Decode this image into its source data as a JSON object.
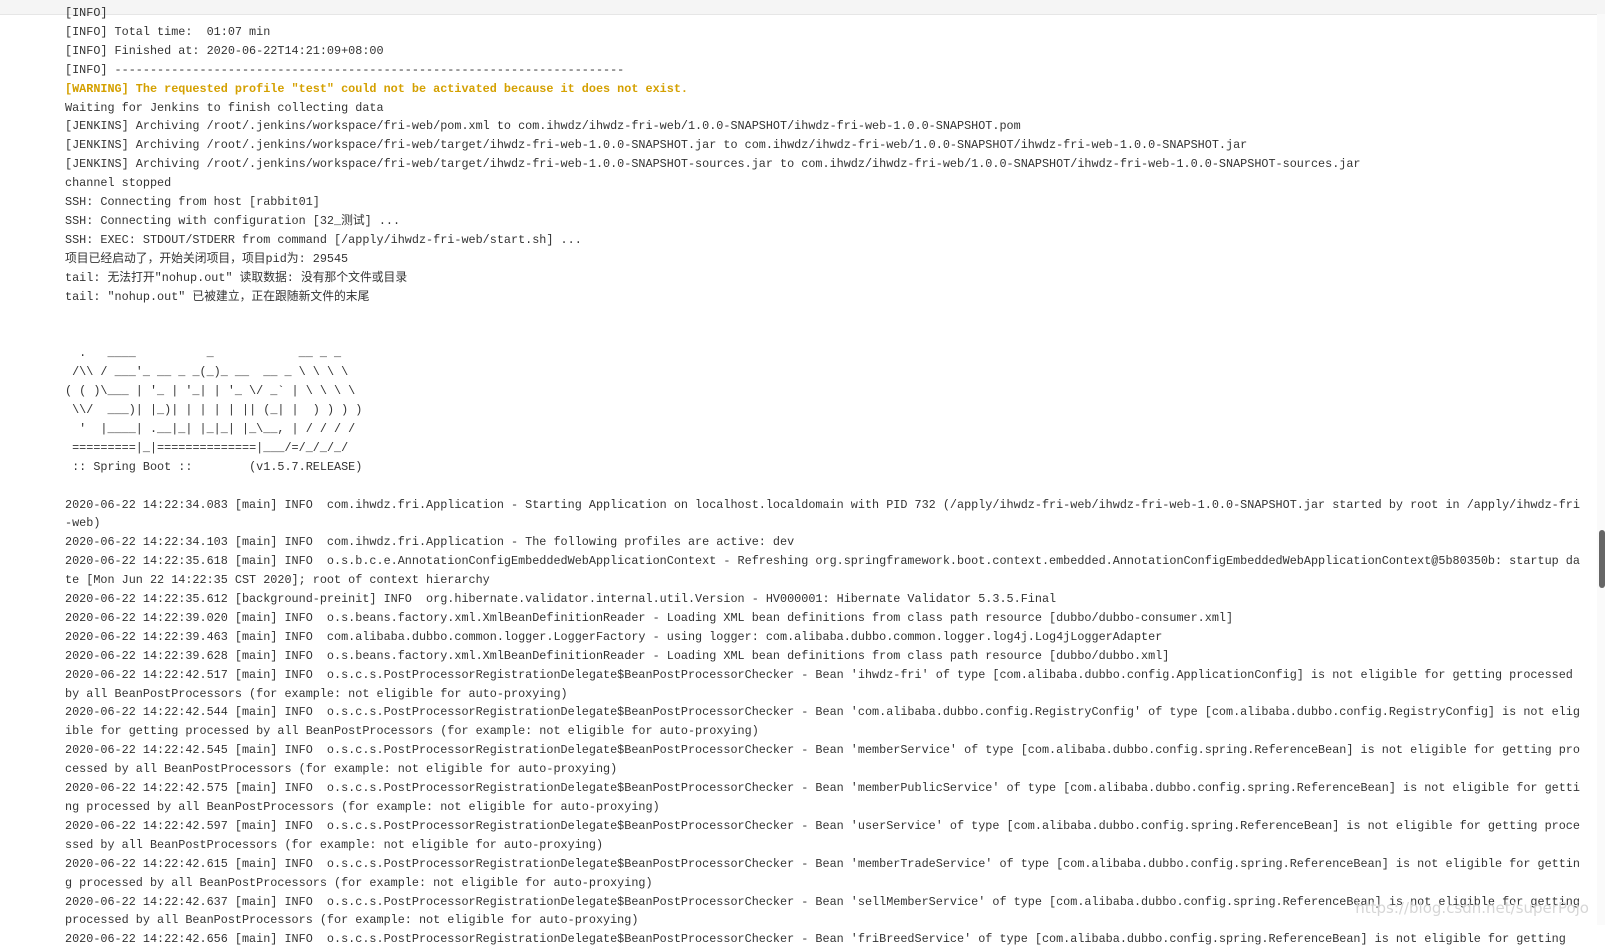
{
  "lines": [
    {
      "text": "[INFO]",
      "cls": ""
    },
    {
      "text": "[INFO] Total time:  01:07 min",
      "cls": ""
    },
    {
      "text": "[INFO] Finished at: 2020-06-22T14:21:09+08:00",
      "cls": ""
    },
    {
      "text": "[INFO] ------------------------------------------------------------------------",
      "cls": ""
    },
    {
      "text": "[WARNING] The requested profile \"test\" could not be activated because it does not exist.",
      "cls": "warn"
    },
    {
      "text": "Waiting for Jenkins to finish collecting data",
      "cls": ""
    },
    {
      "text": "[JENKINS] Archiving /root/.jenkins/workspace/fri-web/pom.xml to com.ihwdz/ihwdz-fri-web/1.0.0-SNAPSHOT/ihwdz-fri-web-1.0.0-SNAPSHOT.pom",
      "cls": ""
    },
    {
      "text": "[JENKINS] Archiving /root/.jenkins/workspace/fri-web/target/ihwdz-fri-web-1.0.0-SNAPSHOT.jar to com.ihwdz/ihwdz-fri-web/1.0.0-SNAPSHOT/ihwdz-fri-web-1.0.0-SNAPSHOT.jar",
      "cls": ""
    },
    {
      "text": "[JENKINS] Archiving /root/.jenkins/workspace/fri-web/target/ihwdz-fri-web-1.0.0-SNAPSHOT-sources.jar to com.ihwdz/ihwdz-fri-web/1.0.0-SNAPSHOT/ihwdz-fri-web-1.0.0-SNAPSHOT-sources.jar",
      "cls": ""
    },
    {
      "text": "channel stopped",
      "cls": ""
    },
    {
      "text": "SSH: Connecting from host [rabbit01]",
      "cls": ""
    },
    {
      "text": "SSH: Connecting with configuration [32_测试] ...",
      "cls": ""
    },
    {
      "text": "SSH: EXEC: STDOUT/STDERR from command [/apply/ihwdz-fri-web/start.sh] ...",
      "cls": ""
    },
    {
      "text": "项目已经启动了，开始关闭项目，项目pid为: 29545",
      "cls": ""
    },
    {
      "text": "tail: 无法打开\"nohup.out\" 读取数据: 没有那个文件或目录",
      "cls": ""
    },
    {
      "text": "tail: \"nohup.out\" 已被建立，正在跟随新文件的末尾",
      "cls": ""
    },
    {
      "text": "",
      "cls": ""
    },
    {
      "text": "",
      "cls": ""
    },
    {
      "text": "  .   ____          _            __ _ _",
      "cls": ""
    },
    {
      "text": " /\\\\ / ___'_ __ _ _(_)_ __  __ _ \\ \\ \\ \\",
      "cls": ""
    },
    {
      "text": "( ( )\\___ | '_ | '_| | '_ \\/ _` | \\ \\ \\ \\",
      "cls": ""
    },
    {
      "text": " \\\\/  ___)| |_)| | | | | || (_| |  ) ) ) )",
      "cls": ""
    },
    {
      "text": "  '  |____| .__|_| |_|_| |_\\__, | / / / /",
      "cls": ""
    },
    {
      "text": " =========|_|==============|___/=/_/_/_/",
      "cls": ""
    },
    {
      "text": " :: Spring Boot ::        (v1.5.7.RELEASE)",
      "cls": ""
    },
    {
      "text": "",
      "cls": ""
    },
    {
      "text": "2020-06-22 14:22:34.083 [main] INFO  com.ihwdz.fri.Application - Starting Application on localhost.localdomain with PID 732 (/apply/ihwdz-fri-web/ihwdz-fri-web-1.0.0-SNAPSHOT.jar started by root in /apply/ihwdz-fri-web)",
      "cls": ""
    },
    {
      "text": "2020-06-22 14:22:34.103 [main] INFO  com.ihwdz.fri.Application - The following profiles are active: dev",
      "cls": ""
    },
    {
      "text": "2020-06-22 14:22:35.618 [main] INFO  o.s.b.c.e.AnnotationConfigEmbeddedWebApplicationContext - Refreshing org.springframework.boot.context.embedded.AnnotationConfigEmbeddedWebApplicationContext@5b80350b: startup date [Mon Jun 22 14:22:35 CST 2020]; root of context hierarchy",
      "cls": ""
    },
    {
      "text": "2020-06-22 14:22:35.612 [background-preinit] INFO  org.hibernate.validator.internal.util.Version - HV000001: Hibernate Validator 5.3.5.Final",
      "cls": ""
    },
    {
      "text": "2020-06-22 14:22:39.020 [main] INFO  o.s.beans.factory.xml.XmlBeanDefinitionReader - Loading XML bean definitions from class path resource [dubbo/dubbo-consumer.xml]",
      "cls": ""
    },
    {
      "text": "2020-06-22 14:22:39.463 [main] INFO  com.alibaba.dubbo.common.logger.LoggerFactory - using logger: com.alibaba.dubbo.common.logger.log4j.Log4jLoggerAdapter",
      "cls": ""
    },
    {
      "text": "2020-06-22 14:22:39.628 [main] INFO  o.s.beans.factory.xml.XmlBeanDefinitionReader - Loading XML bean definitions from class path resource [dubbo/dubbo.xml]",
      "cls": ""
    },
    {
      "text": "2020-06-22 14:22:42.517 [main] INFO  o.s.c.s.PostProcessorRegistrationDelegate$BeanPostProcessorChecker - Bean 'ihwdz-fri' of type [com.alibaba.dubbo.config.ApplicationConfig] is not eligible for getting processed by all BeanPostProcessors (for example: not eligible for auto-proxying)",
      "cls": ""
    },
    {
      "text": "2020-06-22 14:22:42.544 [main] INFO  o.s.c.s.PostProcessorRegistrationDelegate$BeanPostProcessorChecker - Bean 'com.alibaba.dubbo.config.RegistryConfig' of type [com.alibaba.dubbo.config.RegistryConfig] is not eligible for getting processed by all BeanPostProcessors (for example: not eligible for auto-proxying)",
      "cls": ""
    },
    {
      "text": "2020-06-22 14:22:42.545 [main] INFO  o.s.c.s.PostProcessorRegistrationDelegate$BeanPostProcessorChecker - Bean 'memberService' of type [com.alibaba.dubbo.config.spring.ReferenceBean] is not eligible for getting processed by all BeanPostProcessors (for example: not eligible for auto-proxying)",
      "cls": ""
    },
    {
      "text": "2020-06-22 14:22:42.575 [main] INFO  o.s.c.s.PostProcessorRegistrationDelegate$BeanPostProcessorChecker - Bean 'memberPublicService' of type [com.alibaba.dubbo.config.spring.ReferenceBean] is not eligible for getting processed by all BeanPostProcessors (for example: not eligible for auto-proxying)",
      "cls": ""
    },
    {
      "text": "2020-06-22 14:22:42.597 [main] INFO  o.s.c.s.PostProcessorRegistrationDelegate$BeanPostProcessorChecker - Bean 'userService' of type [com.alibaba.dubbo.config.spring.ReferenceBean] is not eligible for getting processed by all BeanPostProcessors (for example: not eligible for auto-proxying)",
      "cls": ""
    },
    {
      "text": "2020-06-22 14:22:42.615 [main] INFO  o.s.c.s.PostProcessorRegistrationDelegate$BeanPostProcessorChecker - Bean 'memberTradeService' of type [com.alibaba.dubbo.config.spring.ReferenceBean] is not eligible for getting processed by all BeanPostProcessors (for example: not eligible for auto-proxying)",
      "cls": ""
    },
    {
      "text": "2020-06-22 14:22:42.637 [main] INFO  o.s.c.s.PostProcessorRegistrationDelegate$BeanPostProcessorChecker - Bean 'sellMemberService' of type [com.alibaba.dubbo.config.spring.ReferenceBean] is not eligible for getting processed by all BeanPostProcessors (for example: not eligible for auto-proxying)",
      "cls": ""
    },
    {
      "text": "2020-06-22 14:22:42.656 [main] INFO  o.s.c.s.PostProcessorRegistrationDelegate$BeanPostProcessorChecker - Bean 'friBreedService' of type [com.alibaba.dubbo.config.spring.ReferenceBean] is not eligible for getting",
      "cls": ""
    }
  ],
  "watermark": "https://blog.csdn.net/superPojo"
}
